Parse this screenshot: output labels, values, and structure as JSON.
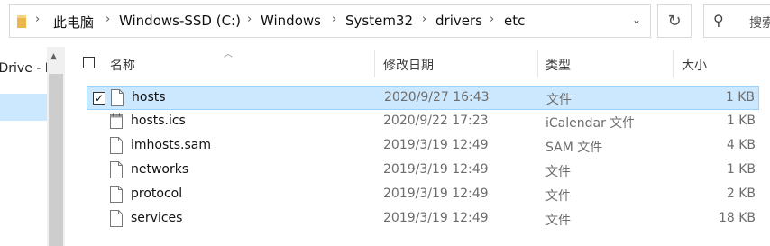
{
  "address_bar": {
    "breadcrumbs": [
      "此电脑",
      "Windows-SSD (C:)",
      "Windows",
      "System32",
      "drivers",
      "etc"
    ]
  },
  "search": {
    "placeholder": "搜索"
  },
  "nav": {
    "item_label": "OneDrive - Personal"
  },
  "columns": {
    "name": "名称",
    "date": "修改日期",
    "type": "类型",
    "size": "大小"
  },
  "files": [
    {
      "name": "hosts",
      "date": "2020/9/27 16:43",
      "type": "文件",
      "size": "1 KB",
      "icon": "file-icon",
      "selected": true
    },
    {
      "name": "hosts.ics",
      "date": "2020/9/22 17:23",
      "type": "iCalendar 文件",
      "size": "1 KB",
      "icon": "calendar-file-icon",
      "selected": false
    },
    {
      "name": "lmhosts.sam",
      "date": "2019/3/19 12:49",
      "type": "SAM 文件",
      "size": "4 KB",
      "icon": "file-icon",
      "selected": false
    },
    {
      "name": "networks",
      "date": "2019/3/19 12:49",
      "type": "文件",
      "size": "1 KB",
      "icon": "file-icon",
      "selected": false
    },
    {
      "name": "protocol",
      "date": "2019/3/19 12:49",
      "type": "文件",
      "size": "2 KB",
      "icon": "file-icon",
      "selected": false
    },
    {
      "name": "services",
      "date": "2019/3/19 12:49",
      "type": "文件",
      "size": "18 KB",
      "icon": "file-icon",
      "selected": false
    }
  ],
  "colors": {
    "selection_bg": "#cce8ff",
    "selection_border": "#99d1ff",
    "folder": "#e8b84a"
  }
}
